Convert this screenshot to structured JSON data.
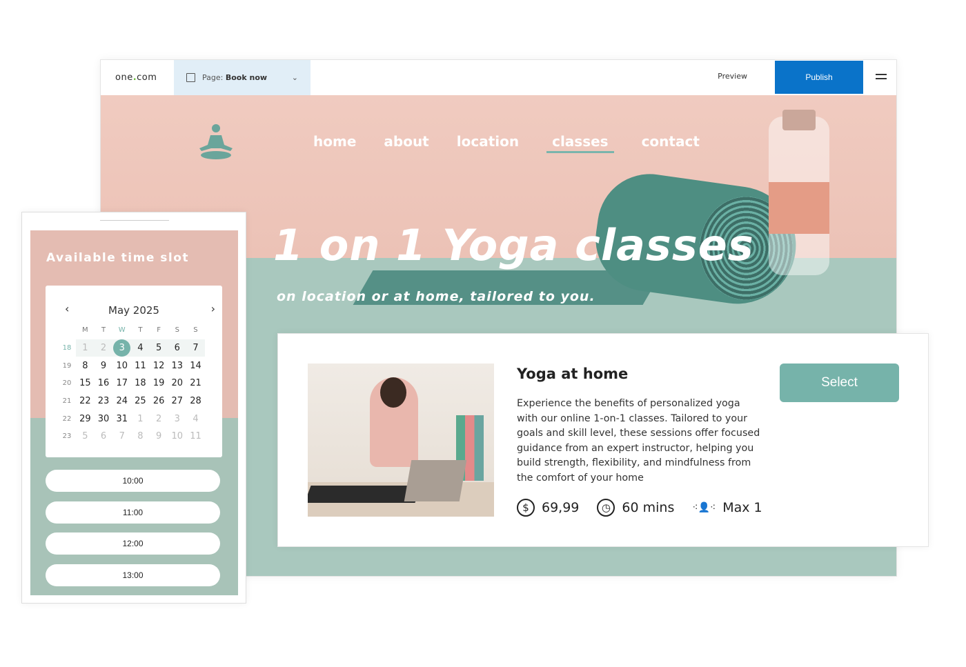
{
  "editor": {
    "logo_text": "one",
    "logo_dot": ".",
    "logo_tld": "com",
    "page_prefix": "Page:",
    "page_name": "Book now",
    "preview": "Preview",
    "publish": "Publish"
  },
  "site": {
    "nav": [
      "home",
      "about",
      "location",
      "classes",
      "contact"
    ],
    "active_nav": "classes",
    "hero_title": "1 on 1 Yoga classes",
    "hero_subtitle": "on location or at home, tailored to you."
  },
  "booking": {
    "title": "Available time slot",
    "calendar": {
      "month": "May 2025",
      "weekdays": [
        "M",
        "T",
        "W",
        "T",
        "F",
        "S",
        "S"
      ],
      "today_weekday_index": 2,
      "weeks": [
        {
          "week": "18",
          "days": [
            "1",
            "2",
            "3",
            "4",
            "5",
            "6",
            "7"
          ]
        },
        {
          "week": "19",
          "days": [
            "8",
            "9",
            "10",
            "11",
            "12",
            "13",
            "14"
          ]
        },
        {
          "week": "20",
          "days": [
            "15",
            "16",
            "17",
            "18",
            "19",
            "20",
            "21"
          ]
        },
        {
          "week": "21",
          "days": [
            "22",
            "23",
            "24",
            "25",
            "26",
            "27",
            "28"
          ]
        },
        {
          "week": "22",
          "days": [
            "29",
            "30",
            "31",
            "1",
            "2",
            "3",
            "4"
          ]
        },
        {
          "week": "23",
          "days": [
            "5",
            "6",
            "7",
            "8",
            "9",
            "10",
            "11"
          ]
        }
      ],
      "selected_day": "3"
    },
    "slots": [
      "10:00",
      "11:00",
      "12:00",
      "13:00"
    ]
  },
  "card": {
    "title": "Yoga at home",
    "description": "Experience the benefits of personalized yoga with our online 1-on-1 classes. Tailored to your goals and skill level, these sessions offer focused guidance from an expert instructor, helping you build strength, flexibility, and mindfulness from the comfort of your home",
    "price": "69,99",
    "duration": "60 mins",
    "capacity": "Max 1",
    "select": "Select"
  },
  "colors": {
    "accent": "#76b3aa",
    "hero_pink": "#f0cbc0",
    "publish_blue": "#0a73c9"
  }
}
